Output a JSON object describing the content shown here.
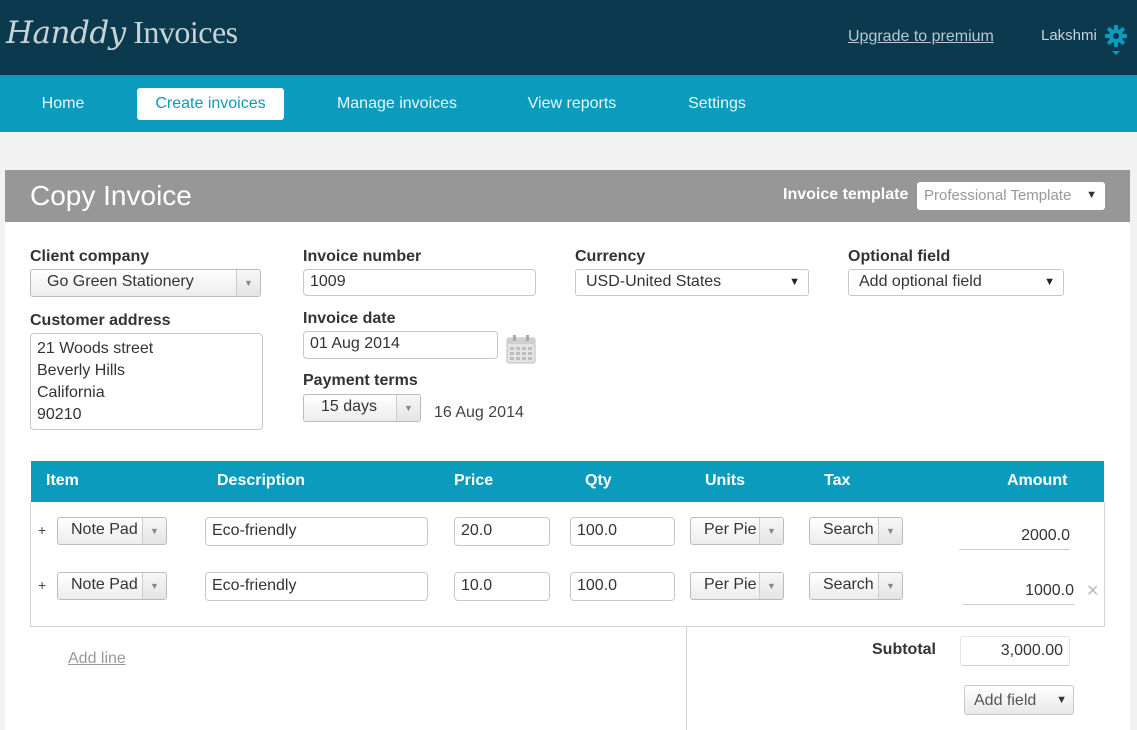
{
  "app": {
    "logo_script": "Handdy",
    "logo_plain": " Invoices",
    "upgrade_link": "Upgrade to premium",
    "user_name": "Lakshmi"
  },
  "nav": {
    "items": [
      {
        "label": "Home"
      },
      {
        "label": "Create invoices",
        "active": true
      },
      {
        "label": "Manage invoices"
      },
      {
        "label": "View reports"
      },
      {
        "label": "Settings"
      }
    ]
  },
  "header": {
    "title": "Copy Invoice",
    "template_label": "Invoice template",
    "template_value": "Professional Template"
  },
  "form": {
    "client_company_label": "Client company",
    "client_company_value": "Go Green Stationery",
    "customer_address_label": "Customer address",
    "customer_address_lines": [
      "21 Woods street",
      "Beverly Hills",
      "California",
      "90210"
    ],
    "invoice_number_label": "Invoice number",
    "invoice_number_value": "1009",
    "invoice_date_label": "Invoice date",
    "invoice_date_value": "01 Aug 2014",
    "payment_terms_label": "Payment terms",
    "payment_terms_value": "15 days",
    "due_date": "16 Aug 2014",
    "currency_label": "Currency",
    "currency_value": "USD-United States",
    "optional_field_label": "Optional field",
    "optional_field_value": "Add optional field"
  },
  "table": {
    "columns": [
      "Item",
      "Description",
      "Price",
      "Qty",
      "Units",
      "Tax",
      "Amount"
    ],
    "rows": [
      {
        "item": "Note Pad",
        "description": "Eco-friendly",
        "price": "20.0",
        "qty": "100.0",
        "units": "Per Pie",
        "tax": "Search",
        "amount": "2000.0"
      },
      {
        "item": "Note Pad",
        "description": "Eco-friendly",
        "price": "10.0",
        "qty": "100.0",
        "units": "Per Pie",
        "tax": "Search",
        "amount": "1000.0"
      }
    ],
    "row_add_symbol": "+",
    "row_delete_symbol": "✕"
  },
  "footer": {
    "add_line": "Add line",
    "subtotal_label": "Subtotal",
    "subtotal_value": "3,000.00",
    "add_field": "Add field"
  },
  "icons": {
    "gear": "gear-icon",
    "calendar": "calendar-icon",
    "dropdown": "chevron-down-icon"
  },
  "colors": {
    "topbar": "#0b3a4f",
    "navbar": "#0a9bbd",
    "header": "#979797",
    "table_header": "#0a9bbd"
  }
}
